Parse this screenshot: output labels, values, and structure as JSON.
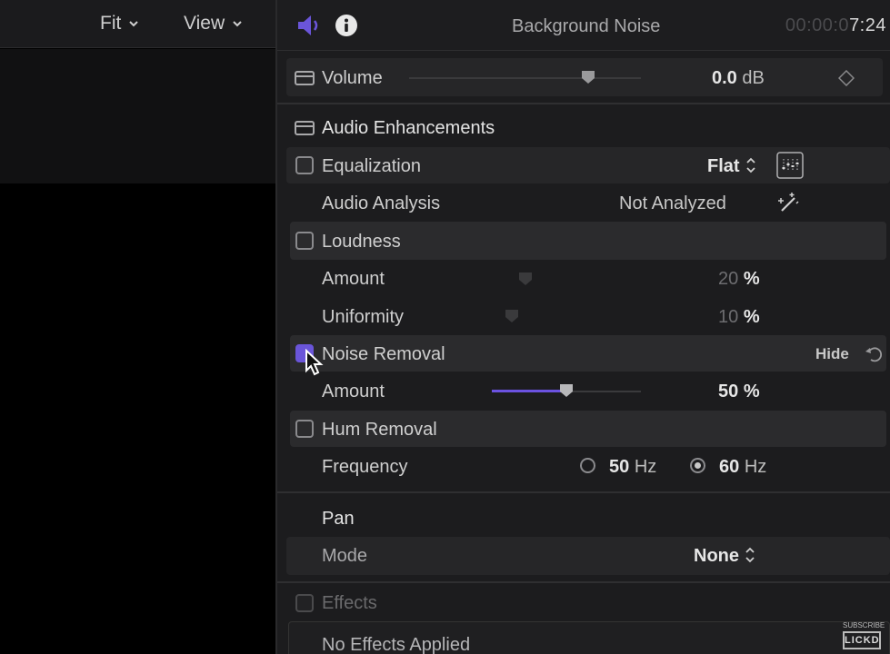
{
  "viewer": {
    "fit_label": "Fit",
    "view_label": "View"
  },
  "inspector": {
    "header": {
      "title": "Background Noise",
      "timecode_dim": "00:00:0",
      "timecode_bright": "7:24"
    },
    "volume": {
      "label": "Volume",
      "value": "0.0",
      "unit": "dB"
    },
    "audio_enhancements": {
      "title": "Audio Enhancements",
      "equalization": {
        "label": "Equalization",
        "preset": "Flat"
      },
      "audio_analysis": {
        "label": "Audio Analysis",
        "status": "Not Analyzed"
      },
      "loudness": {
        "label": "Loudness",
        "amount_label": "Amount",
        "amount_value": "20",
        "uniformity_label": "Uniformity",
        "uniformity_value": "10",
        "unit": "%"
      },
      "noise_removal": {
        "label": "Noise Removal",
        "hide_label": "Hide",
        "amount_label": "Amount",
        "amount_value": "50",
        "unit": "%",
        "amount_fraction": 0.5
      },
      "hum_removal": {
        "label": "Hum Removal",
        "frequency_label": "Frequency",
        "option_50": "50",
        "option_60": "60",
        "unit": "Hz",
        "selected": "60"
      }
    },
    "pan": {
      "title": "Pan",
      "mode_label": "Mode",
      "mode_value": "None"
    },
    "effects": {
      "label": "Effects",
      "empty_text": "No Effects Applied"
    },
    "watermark": {
      "top": "SUBSCRIBE",
      "brand": "LICKD"
    },
    "colors": {
      "accent": "#6a55d9",
      "background": "#1c1c1e"
    }
  }
}
